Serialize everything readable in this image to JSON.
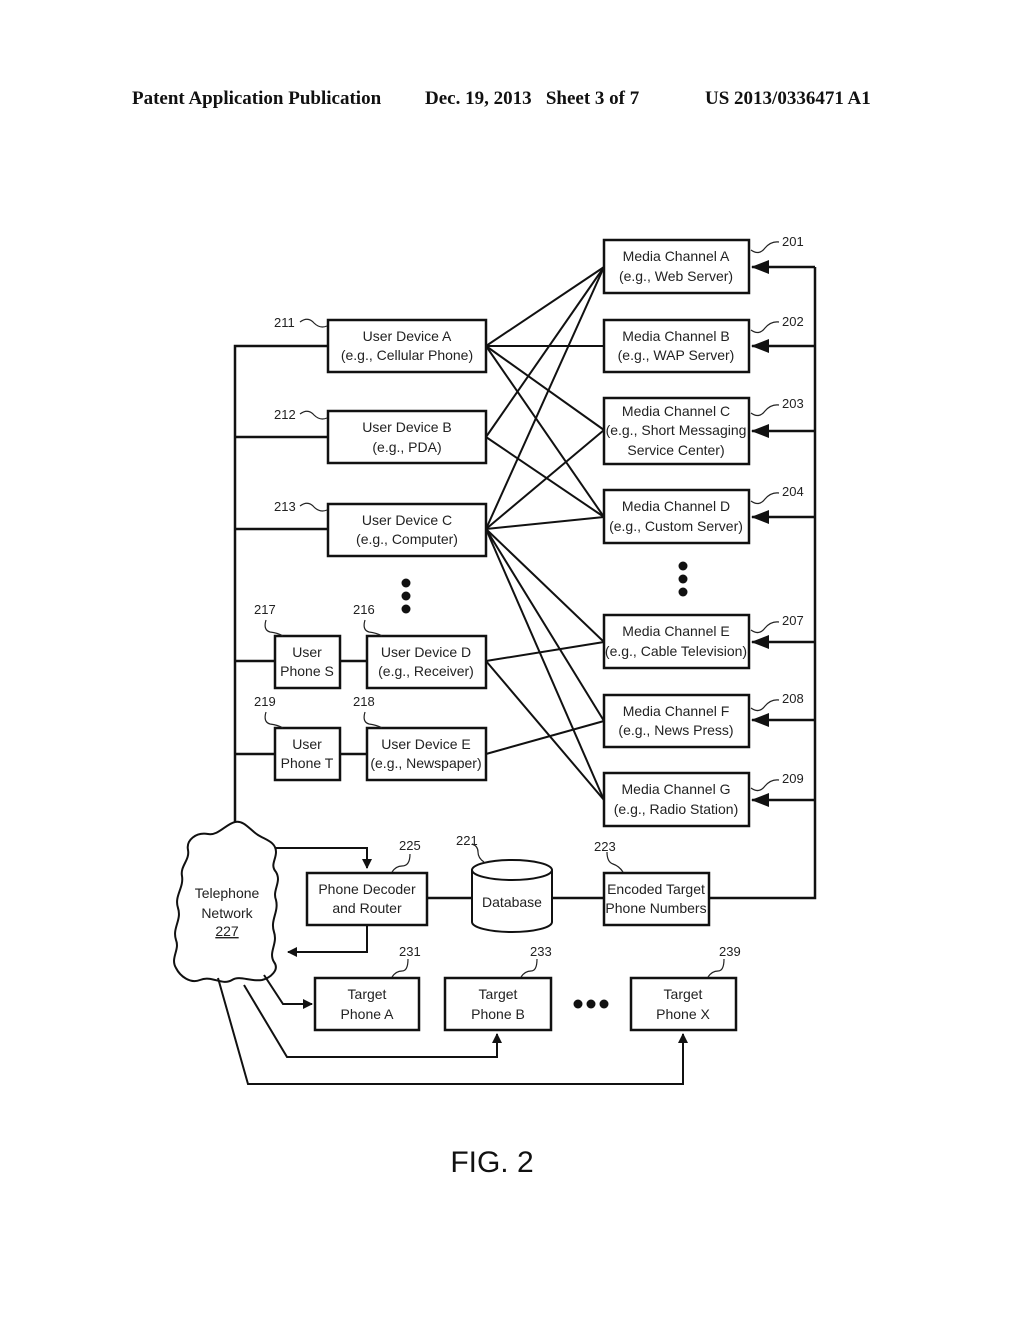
{
  "header": {
    "publication": "Patent Application Publication",
    "date_sheet": "Dec. 19, 2013   Sheet 3 of 7",
    "patent_number": "US 2013/0336471 A1"
  },
  "media_channels": [
    {
      "ref": "201",
      "line1": "Media Channel  A",
      "line2": "(e.g., Web Server)"
    },
    {
      "ref": "202",
      "line1": "Media Channel  B",
      "line2": "(e.g., WAP Server)"
    },
    {
      "ref": "203",
      "line1": "Media Channel  C",
      "line2": "(e.g., Short Messaging",
      "line3": "Service Center)"
    },
    {
      "ref": "204",
      "line1": "Media Channel  D",
      "line2": "(e.g., Custom Server)"
    },
    {
      "ref": "207",
      "line1": "Media Channel  E",
      "line2": "(e.g., Cable Television)"
    },
    {
      "ref": "208",
      "line1": "Media Channel  F",
      "line2": "(e.g., News Press)"
    },
    {
      "ref": "209",
      "line1": "Media Channel  G",
      "line2": "(e.g., Radio Station)"
    }
  ],
  "user_devices": [
    {
      "ref": "211",
      "line1": "User Device  A",
      "line2": "(e.g., Cellular Phone)"
    },
    {
      "ref": "212",
      "line1": "User Device  B",
      "line2": "(e.g., PDA)"
    },
    {
      "ref": "213",
      "line1": "User Device  C",
      "line2": "(e.g., Computer)"
    },
    {
      "ref": "216",
      "line1": "User Device  D",
      "line2": "(e.g., Receiver)"
    },
    {
      "ref": "218",
      "line1": "User Device  E",
      "line2": "(e.g., Newspaper)"
    }
  ],
  "user_phones": [
    {
      "ref": "217",
      "line1": "User",
      "line2": "Phone S"
    },
    {
      "ref": "219",
      "line1": "User",
      "line2": "Phone T"
    }
  ],
  "telephone_network": {
    "line1": "Telephone",
    "line2": "Network",
    "ref": "227"
  },
  "phone_decoder": {
    "ref": "225",
    "line1": "Phone Decoder",
    "line2": "and Router"
  },
  "database": {
    "ref": "221",
    "label": "Database"
  },
  "encoded_numbers": {
    "ref": "223",
    "line1": "Encoded Target",
    "line2": "Phone Numbers"
  },
  "target_phones": [
    {
      "ref": "231",
      "line1": "Target",
      "line2": "Phone A"
    },
    {
      "ref": "233",
      "line1": "Target",
      "line2": "Phone B"
    },
    {
      "ref": "239",
      "line1": "Target",
      "line2": "Phone X"
    }
  ],
  "connections": {
    "device_to_channel": [
      [
        0,
        0
      ],
      [
        0,
        1
      ],
      [
        0,
        2
      ],
      [
        0,
        3
      ],
      [
        1,
        0
      ],
      [
        1,
        3
      ],
      [
        2,
        0
      ],
      [
        2,
        2
      ],
      [
        2,
        3
      ],
      [
        2,
        4
      ],
      [
        2,
        5
      ],
      [
        2,
        6
      ],
      [
        3,
        4
      ],
      [
        3,
        6
      ],
      [
        4,
        5
      ]
    ]
  },
  "figure_label": "FIG. 2"
}
